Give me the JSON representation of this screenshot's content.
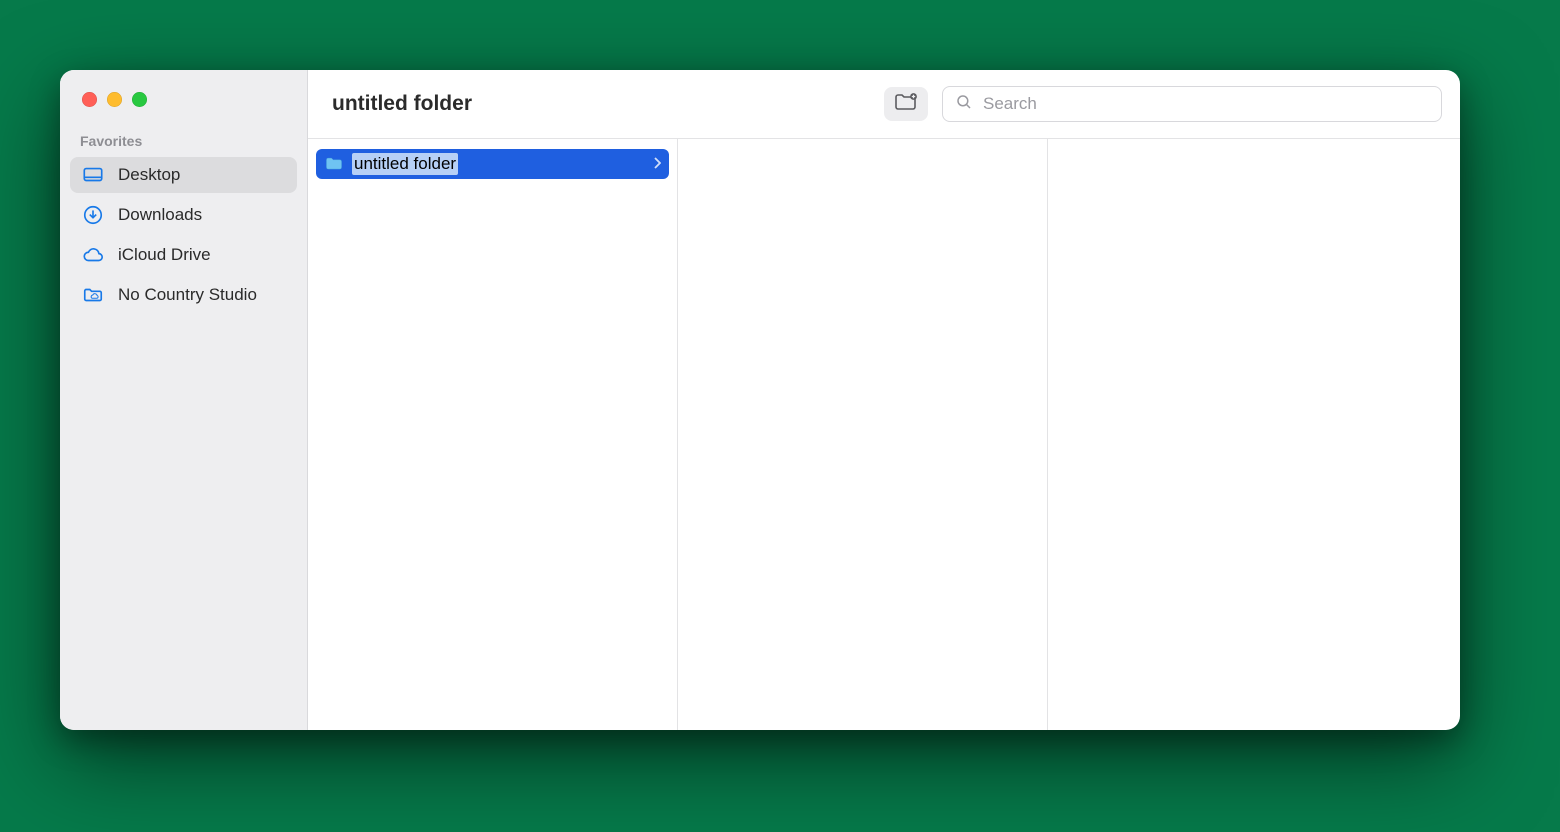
{
  "window": {
    "title": "untitled folder"
  },
  "sidebar": {
    "section_label": "Favorites",
    "items": [
      {
        "icon": "desktop",
        "label": "Desktop",
        "active": true
      },
      {
        "icon": "download",
        "label": "Downloads",
        "active": false
      },
      {
        "icon": "cloud",
        "label": "iCloud Drive",
        "active": false
      },
      {
        "icon": "studio",
        "label": "No Country Studio",
        "active": false
      }
    ]
  },
  "toolbar": {
    "new_folder_label": "New Folder",
    "search_placeholder": "Search"
  },
  "columns": [
    {
      "items": [
        {
          "name": "untitled folder",
          "selected": true,
          "editing": true,
          "has_children": true
        }
      ]
    },
    {
      "items": []
    },
    {
      "items": []
    }
  ],
  "colors": {
    "selection": "#1f5fe0",
    "accent_icon": "#1879e8"
  }
}
